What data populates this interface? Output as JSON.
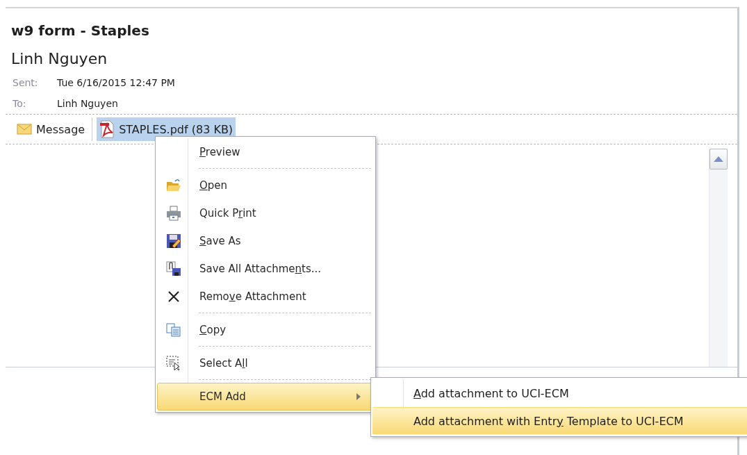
{
  "message": {
    "subject": "w9 form - Staples",
    "sender": "Linh Nguyen",
    "fields": [
      {
        "label": "Sent:",
        "value": "Tue 6/16/2015 12:47 PM"
      },
      {
        "label": "To:",
        "value": "Linh Nguyen"
      }
    ]
  },
  "attachments": [
    {
      "kind": "message",
      "label": "Message",
      "selected": false
    },
    {
      "kind": "pdf",
      "label": "STAPLES.pdf (83 KB)",
      "selected": true
    }
  ],
  "context_menu": {
    "items": [
      {
        "kind": "item",
        "label": "Preview",
        "selected": false
      },
      {
        "kind": "separator"
      },
      {
        "kind": "item",
        "label": "Open",
        "selected": false
      },
      {
        "kind": "item",
        "label": "Quick Print",
        "selected": false
      },
      {
        "kind": "item",
        "label": "Save As",
        "selected": false
      },
      {
        "kind": "item",
        "label": "Save All Attachments...",
        "selected": false
      },
      {
        "kind": "item",
        "label": "Remove Attachment",
        "selected": false
      },
      {
        "kind": "separator"
      },
      {
        "kind": "item",
        "label": "Copy",
        "selected": false
      },
      {
        "kind": "separator"
      },
      {
        "kind": "item",
        "label": "Select All",
        "selected": false
      },
      {
        "kind": "separator"
      },
      {
        "kind": "item",
        "label": "ECM Add",
        "selected": true,
        "submenu": true
      }
    ]
  },
  "submenu": {
    "items": [
      {
        "label": "Add attachment to UCI-ECM",
        "selected": false
      },
      {
        "label": "Add attachment with Entry Template to UCI-ECM",
        "selected": true
      }
    ]
  }
}
